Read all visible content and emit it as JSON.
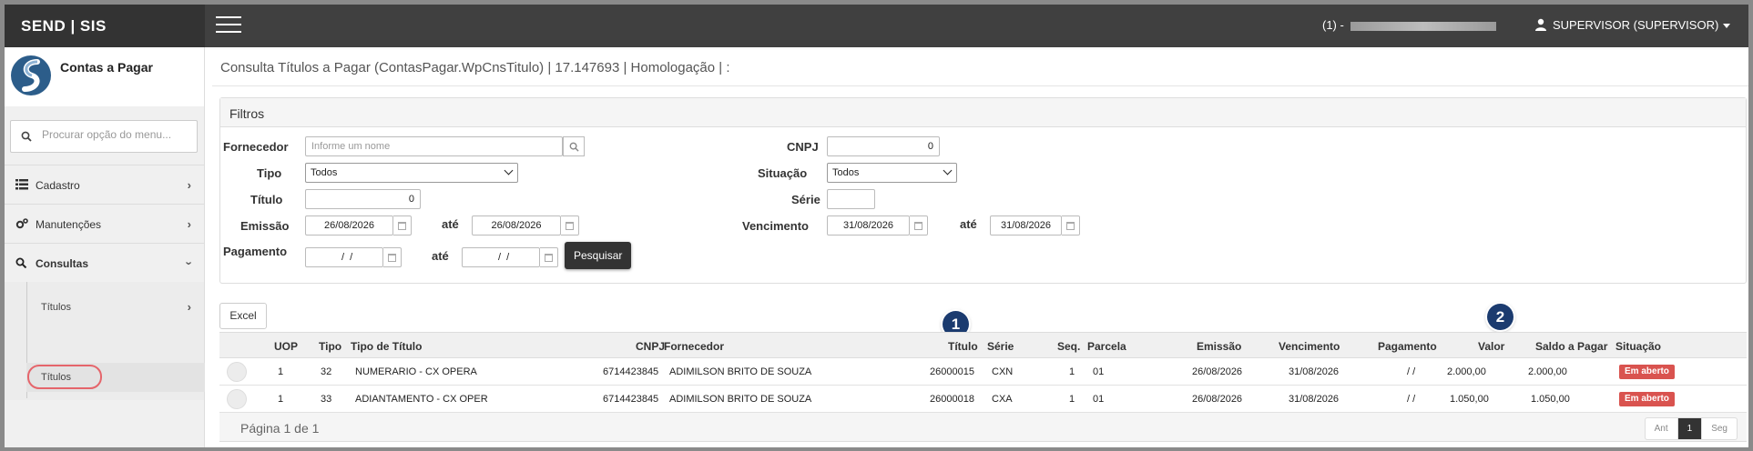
{
  "app": {
    "brand": "SEND | SIS",
    "connection_prefix": "(1) -",
    "user_label": "SUPERVISOR (SUPERVISOR)"
  },
  "sidebar": {
    "module_title": "Contas a Pagar",
    "search_placeholder": "Procurar opção do menu...",
    "items": [
      {
        "label": "Cadastro",
        "icon": "list-icon"
      },
      {
        "label": "Manutenções",
        "icon": "gears-icon"
      },
      {
        "label": "Consultas",
        "icon": "search-icon"
      }
    ],
    "sub_items": [
      {
        "label": "Títulos"
      },
      {
        "label": "Títulos"
      }
    ]
  },
  "page": {
    "title": "Consulta Títulos a Pagar (ContasPagar.WpCnsTitulo) | 17.147693 | Homologação | :"
  },
  "filters": {
    "panel_title": "Filtros",
    "fornecedor_label": "Fornecedor",
    "fornecedor_placeholder": "Informe um nome",
    "cnpj_label": "CNPJ",
    "cnpj_value": "0",
    "tipo_label": "Tipo",
    "tipo_value": "Todos",
    "situacao_label": "Situação",
    "situacao_value": "Todos",
    "titulo_label": "Título",
    "titulo_value": "0",
    "serie_label": "Série",
    "serie_value": "",
    "emissao_label": "Emissão",
    "emissao_from": "26/08/2026",
    "ate_label": "até",
    "emissao_to": "26/08/2026",
    "vencimento_label": "Vencimento",
    "vencimento_from": "31/08/2026",
    "vencimento_to": "31/08/2026",
    "pagamento_label": "Pagamento",
    "pagamento_from": "  /  /",
    "pagamento_to": "  /  /",
    "search_button": "Pesquisar"
  },
  "toolbar": {
    "excel_label": "Excel"
  },
  "callouts": [
    "1",
    "2"
  ],
  "grid": {
    "columns": {
      "uop": "UOP",
      "tipo": "Tipo",
      "tipo_titulo": "Tipo de Título",
      "cnpj": "CNPJ",
      "fornecedor": "Fornecedor",
      "titulo": "Título",
      "serie": "Série",
      "seq": "Seq.",
      "parcela": "Parcela",
      "emissao": "Emissão",
      "vencimento": "Vencimento",
      "pagamento": "Pagamento",
      "valor": "Valor",
      "saldo": "Saldo a Pagar",
      "situacao": "Situação"
    },
    "rows": [
      {
        "uop": "1",
        "tipo": "32",
        "tipo_titulo": "NUMERARIO - CX OPERA",
        "cnpj": "6714423845",
        "fornecedor": "ADIMILSON BRITO DE SOUZA",
        "titulo": "26000015",
        "serie": "CXN",
        "seq": "1",
        "parcela": "01",
        "emissao": "26/08/2026",
        "vencimento": "31/08/2026",
        "pagamento": "/ /",
        "valor": "2.000,00",
        "saldo": "2.000,00",
        "situacao": "Em aberto"
      },
      {
        "uop": "1",
        "tipo": "33",
        "tipo_titulo": "ADIANTAMENTO - CX OPER",
        "cnpj": "6714423845",
        "fornecedor": "ADIMILSON BRITO DE SOUZA",
        "titulo": "26000018",
        "serie": "CXA",
        "seq": "1",
        "parcela": "01",
        "emissao": "26/08/2026",
        "vencimento": "31/08/2026",
        "pagamento": "/ /",
        "valor": "1.050,00",
        "saldo": "1.050,00",
        "situacao": "Em aberto"
      }
    ],
    "page_info": "Página 1 de 1",
    "pager": {
      "prev": "Ant",
      "current": "1",
      "next": "Seg"
    }
  },
  "colors": {
    "topbar": "#404040",
    "status_open": "#d9534f",
    "callout": "#1b3b6f",
    "highlight_ring": "#e5656b"
  }
}
